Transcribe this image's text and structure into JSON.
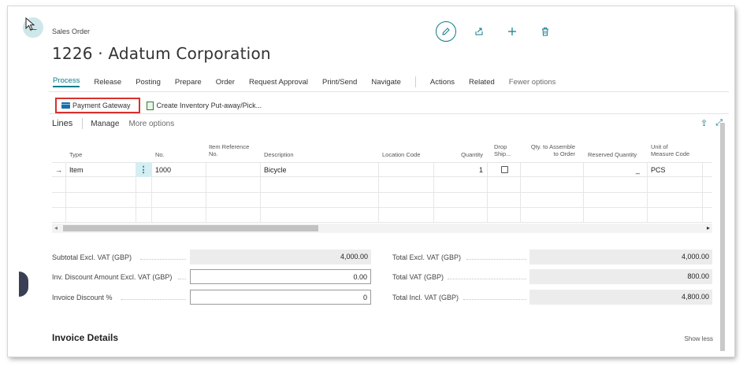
{
  "page": {
    "caption": "Sales Order",
    "title": "1226 · Adatum Corporation"
  },
  "icons": {
    "back": "back-arrow-icon",
    "edit": "edit-pencil-icon",
    "share": "share-icon",
    "new": "plus-icon",
    "delete": "trash-icon"
  },
  "menu": {
    "items": [
      "Process",
      "Release",
      "Posting",
      "Prepare",
      "Order",
      "Request Approval",
      "Print/Send",
      "Navigate"
    ],
    "items2": [
      "Actions",
      "Related"
    ],
    "fewer": "Fewer options"
  },
  "subactions": {
    "payment_gateway": "Payment Gateway",
    "create_inventory": "Create Inventory Put-away/Pick..."
  },
  "lines": {
    "title": "Lines",
    "manage": "Manage",
    "more": "More options",
    "headers": {
      "type": "Type",
      "no": "No.",
      "item_ref_1": "Item Reference",
      "item_ref_2": "No.",
      "description": "Description",
      "location": "Location Code",
      "quantity": "Quantity",
      "drop_1": "Drop",
      "drop_2": "Ship...",
      "qty_asm_1": "Qty. to Assemble",
      "qty_asm_2": "to Order",
      "reserved": "Reserved Quantity",
      "uom_1": "Unit of",
      "uom_2": "Measure Code"
    },
    "rows": [
      {
        "arrow": "→",
        "type": "Item",
        "no": "1000",
        "description": "Bicycle",
        "quantity": "1",
        "drop_ship": false,
        "reserved": "_",
        "uom": "PCS"
      }
    ]
  },
  "totals": {
    "subtotal_label": "Subtotal Excl. VAT (GBP)",
    "subtotal_value": "4,000.00",
    "inv_disc_amt_label": "Inv. Discount Amount Excl. VAT (GBP)",
    "inv_disc_amt_value": "0.00",
    "inv_disc_pct_label": "Invoice Discount %",
    "inv_disc_pct_value": "0",
    "total_excl_label": "Total Excl. VAT (GBP)",
    "total_excl_value": "4,000.00",
    "total_vat_label": "Total VAT (GBP)",
    "total_vat_value": "800.00",
    "total_incl_label": "Total Incl. VAT (GBP)",
    "total_incl_value": "4,800.00"
  },
  "invoice_details": {
    "title": "Invoice Details",
    "show_less": "Show less"
  },
  "colors": {
    "accent": "#0f7b8c",
    "highlight_border": "#d9302c"
  }
}
